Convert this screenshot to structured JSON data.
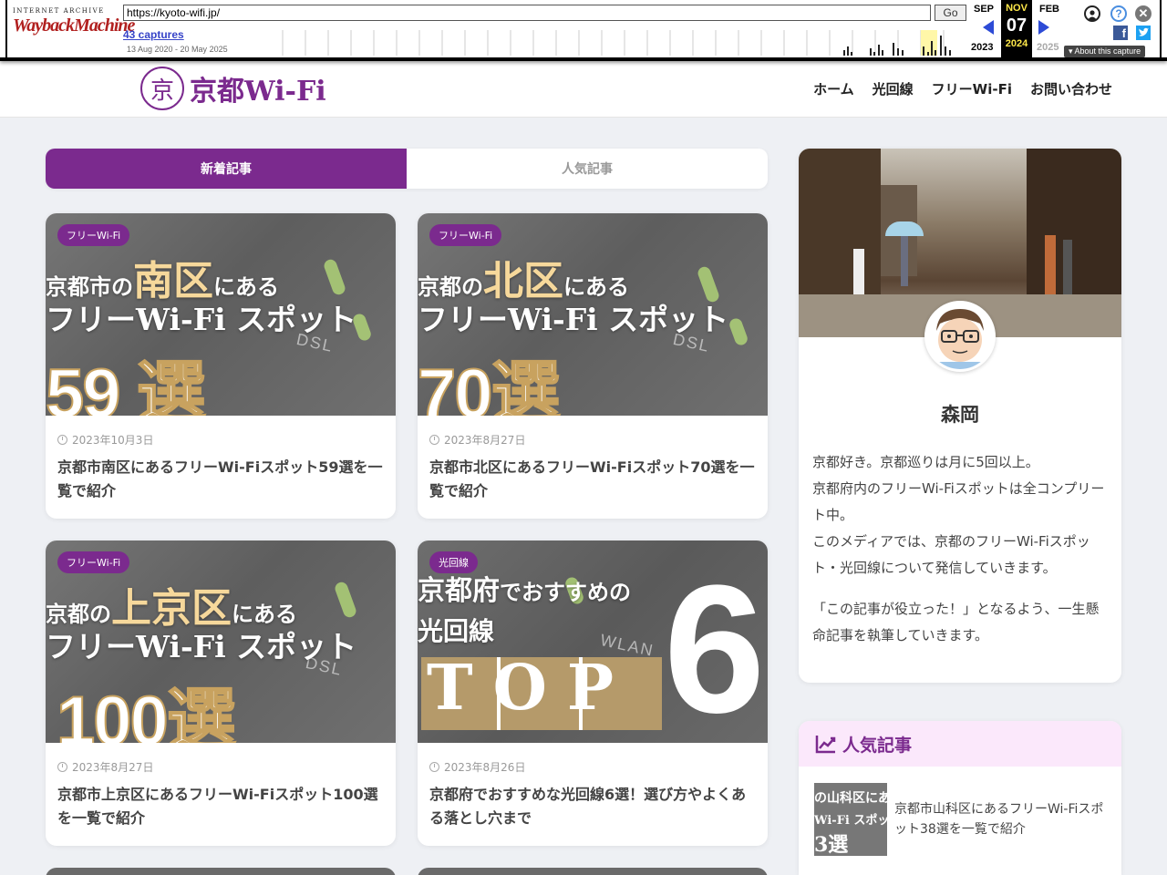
{
  "wayback": {
    "logo_top": "INTERNET ARCHIVE",
    "logo_main": "WaybackMachine",
    "url": "https://kyoto-wifi.jp/",
    "go_label": "Go",
    "captures": "43 captures",
    "range": "13 Aug 2020 - 20 May 2025",
    "prev_month": "SEP",
    "cur_month": "NOV",
    "next_month": "FEB",
    "cur_day": "07",
    "prev_year": "2023",
    "cur_year": "2024",
    "next_year": "2025",
    "about": "About this capture"
  },
  "site": {
    "logo_mark": "京",
    "logo_text": "京都Wi-Fi",
    "nav": [
      "ホーム",
      "光回線",
      "フリーWi-Fi",
      "お問い合わせ"
    ]
  },
  "tabs": {
    "new": "新着記事",
    "popular": "人気記事"
  },
  "cards": [
    {
      "badge": "フリーWi-Fi",
      "line1_pre": "京都市の",
      "line1_em": "南区",
      "line1_post": "にある",
      "line2": "フリーWi-Fi スポット",
      "big": "59 選",
      "date": "2023年10月3日",
      "title": "京都市南区にあるフリーWi-Fiスポット59選を一覧で紹介"
    },
    {
      "badge": "フリーWi-Fi",
      "line1_pre": "京都の",
      "line1_em": "北区",
      "line1_post": "にある",
      "line2": "フリーWi-Fi スポット",
      "big": "70選",
      "date": "2023年8月27日",
      "title": "京都市北区にあるフリーWi-Fiスポット70選を一覧で紹介"
    },
    {
      "badge": "フリーWi-Fi",
      "line1_pre": "京都の",
      "line1_em": "上京区",
      "line1_post": "にある",
      "line2": "フリーWi-Fi スポット",
      "big": "100選",
      "date": "2023年8月27日",
      "title": "京都市上京区にあるフリーWi-Fiスポット100選を一覧で紹介"
    },
    {
      "badge": "光回線",
      "line1_pre": "京都府",
      "line1_em": "",
      "line1_post": "でおすすめの",
      "line2": "光回線",
      "big": "TOP",
      "big2": "6",
      "date": "2023年8月26日",
      "title": "京都府でおすすめな光回線6選！選び方やよくある落とし穴まで"
    }
  ],
  "profile": {
    "name": "森岡",
    "bio": [
      "京都好き。京都巡りは月に5回以上。",
      "京都府内のフリーWi-Fiスポットは全コンプリート中。",
      "このメディアでは、京都のフリーWi-Fiスポット・光回線について発信していきます。",
      "「この記事が役立った！」となるよう、一生懸命記事を執筆していきます。"
    ]
  },
  "popular": {
    "heading": "人気記事",
    "item_thumb_line1": "の山科区にあ",
    "item_thumb_line2": "Wi-Fi スポッ",
    "item_thumb_line3": "3選",
    "item_title": "京都市山科区にあるフリーWi-Fiスポット38選を一覧で紹介"
  },
  "colors": {
    "brand": "#7b2a8e",
    "popular_bg": "#fbe8fb"
  }
}
